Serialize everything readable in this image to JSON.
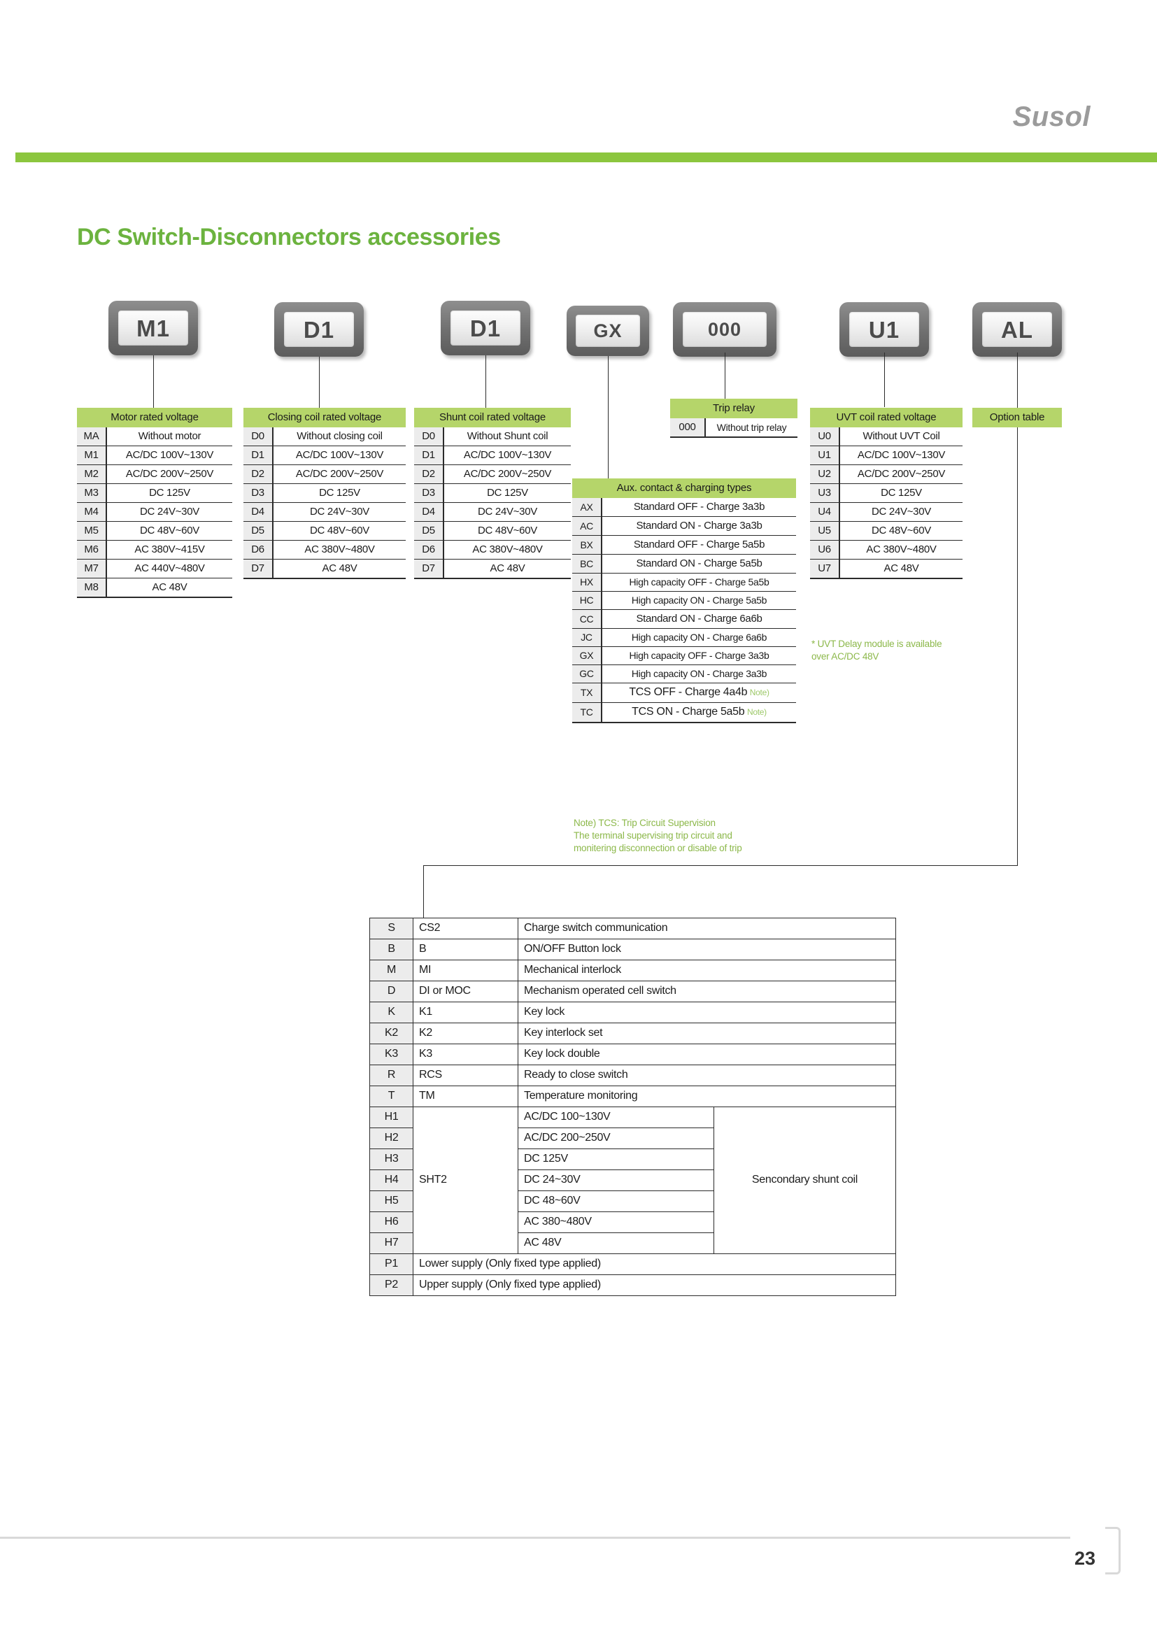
{
  "header": {
    "brand": "Susol"
  },
  "title": "DC Switch-Disconnectors accessories",
  "chips": [
    {
      "code": "M1"
    },
    {
      "code": "D1"
    },
    {
      "code": "D1"
    },
    {
      "code": "GX"
    },
    {
      "code": "000"
    },
    {
      "code": "U1"
    },
    {
      "code": "AL"
    }
  ],
  "motor": {
    "header": "Motor rated voltage",
    "rows": [
      {
        "code": "MA",
        "desc": "Without motor"
      },
      {
        "code": "M1",
        "desc": "AC/DC 100V~130V"
      },
      {
        "code": "M2",
        "desc": "AC/DC 200V~250V"
      },
      {
        "code": "M3",
        "desc": "DC 125V"
      },
      {
        "code": "M4",
        "desc": "DC 24V~30V"
      },
      {
        "code": "M5",
        "desc": "DC 48V~60V"
      },
      {
        "code": "M6",
        "desc": "AC 380V~415V"
      },
      {
        "code": "M7",
        "desc": "AC 440V~480V"
      },
      {
        "code": "M8",
        "desc": "AC 48V"
      }
    ]
  },
  "closing": {
    "header": "Closing coil rated voltage",
    "rows": [
      {
        "code": "D0",
        "desc": "Without closing coil"
      },
      {
        "code": "D1",
        "desc": "AC/DC 100V~130V"
      },
      {
        "code": "D2",
        "desc": "AC/DC 200V~250V"
      },
      {
        "code": "D3",
        "desc": "DC 125V"
      },
      {
        "code": "D4",
        "desc": "DC 24V~30V"
      },
      {
        "code": "D5",
        "desc": "DC 48V~60V"
      },
      {
        "code": "D6",
        "desc": "AC 380V~480V"
      },
      {
        "code": "D7",
        "desc": "AC 48V"
      }
    ]
  },
  "shunt": {
    "header": "Shunt coil rated voltage",
    "rows": [
      {
        "code": "D0",
        "desc": "Without Shunt coil"
      },
      {
        "code": "D1",
        "desc": "AC/DC 100V~130V"
      },
      {
        "code": "D2",
        "desc": "AC/DC 200V~250V"
      },
      {
        "code": "D3",
        "desc": "DC 125V"
      },
      {
        "code": "D4",
        "desc": "DC 24V~30V"
      },
      {
        "code": "D5",
        "desc": "DC 48V~60V"
      },
      {
        "code": "D6",
        "desc": "AC 380V~480V"
      },
      {
        "code": "D7",
        "desc": "AC 48V"
      }
    ]
  },
  "aux": {
    "header": "Aux. contact & charging types",
    "rows": [
      {
        "code": "AX",
        "desc": "Standard OFF - Charge 3a3b",
        "tag": ""
      },
      {
        "code": "AC",
        "desc": "Standard ON - Charge 3a3b",
        "tag": ""
      },
      {
        "code": "BX",
        "desc": "Standard OFF - Charge 5a5b",
        "tag": ""
      },
      {
        "code": "BC",
        "desc": "Standard ON - Charge 5a5b",
        "tag": ""
      },
      {
        "code": "HX",
        "desc": "High capacity OFF - Charge 5a5b",
        "tag": ""
      },
      {
        "code": "HC",
        "desc": "High capacity ON - Charge 5a5b",
        "tag": ""
      },
      {
        "code": "CC",
        "desc": "Standard ON - Charge 6a6b",
        "tag": ""
      },
      {
        "code": "JC",
        "desc": "High capacity ON - Charge 6a6b",
        "tag": ""
      },
      {
        "code": "GX",
        "desc": "High capacity OFF - Charge 3a3b",
        "tag": ""
      },
      {
        "code": "GC",
        "desc": "High capacity ON - Charge 3a3b",
        "tag": ""
      },
      {
        "code": "TX",
        "desc": "TCS OFF - Charge 4a4b",
        "tag": "Note)"
      },
      {
        "code": "TC",
        "desc": "TCS ON - Charge 5a5b",
        "tag": "Note)"
      }
    ],
    "note": "Note) TCS: Trip Circuit Supervision\nThe terminal supervising trip circuit and\nmonitering disconnection or disable of trip"
  },
  "trip": {
    "header": "Trip relay",
    "rows": [
      {
        "code": "000",
        "desc": "Without trip relay"
      }
    ]
  },
  "uvt": {
    "header": "UVT coil rated voltage",
    "rows": [
      {
        "code": "U0",
        "desc": "Without UVT Coil"
      },
      {
        "code": "U1",
        "desc": "AC/DC 100V~130V"
      },
      {
        "code": "U2",
        "desc": "AC/DC 200V~250V"
      },
      {
        "code": "U3",
        "desc": "DC 125V"
      },
      {
        "code": "U4",
        "desc": "DC 24V~30V"
      },
      {
        "code": "U5",
        "desc": "DC 48V~60V"
      },
      {
        "code": "U6",
        "desc": "AC 380V~480V"
      },
      {
        "code": "U7",
        "desc": "AC 48V"
      }
    ],
    "note": "* UVT Delay module is available\n  over AC/DC 48V"
  },
  "option": {
    "header": "Option table",
    "simple_rows_top": [
      {
        "key": "S",
        "mid": "CS2",
        "desc": "Charge switch communication"
      },
      {
        "key": "B",
        "mid": "B",
        "desc": "ON/OFF Button lock"
      },
      {
        "key": "M",
        "mid": "MI",
        "desc": "Mechanical interlock"
      },
      {
        "key": "D",
        "mid": "DI or MOC",
        "desc": "Mechanism operated cell switch"
      },
      {
        "key": "K",
        "mid": "K1",
        "desc": "Key lock"
      },
      {
        "key": "K2",
        "mid": "K2",
        "desc": "Key interlock set"
      },
      {
        "key": "K3",
        "mid": "K3",
        "desc": "Key lock double"
      },
      {
        "key": "R",
        "mid": "RCS",
        "desc": "Ready to close switch"
      },
      {
        "key": "T",
        "mid": "TM",
        "desc": "Temperature monitoring"
      }
    ],
    "sht2_label": "SHT2",
    "sht2_note": "Sencondary shunt coil",
    "sht2_rows": [
      {
        "key": "H1",
        "volt": "AC/DC 100~130V"
      },
      {
        "key": "H2",
        "volt": "AC/DC 200~250V"
      },
      {
        "key": "H3",
        "volt": "DC 125V"
      },
      {
        "key": "H4",
        "volt": "DC 24~30V"
      },
      {
        "key": "H5",
        "volt": "DC 48~60V"
      },
      {
        "key": "H6",
        "volt": "AC 380~480V"
      },
      {
        "key": "H7",
        "volt": "AC 48V"
      }
    ],
    "simple_rows_bottom": [
      {
        "key": "P1",
        "desc": "Lower supply (Only fixed type applied)"
      },
      {
        "key": "P2",
        "desc": "Upper supply (Only fixed type applied)"
      }
    ]
  },
  "footer": {
    "page_number": "23"
  },
  "colors": {
    "brand_green": "#8cc63e",
    "head_green": "#b5d56a",
    "title_green": "#6cb33f"
  }
}
